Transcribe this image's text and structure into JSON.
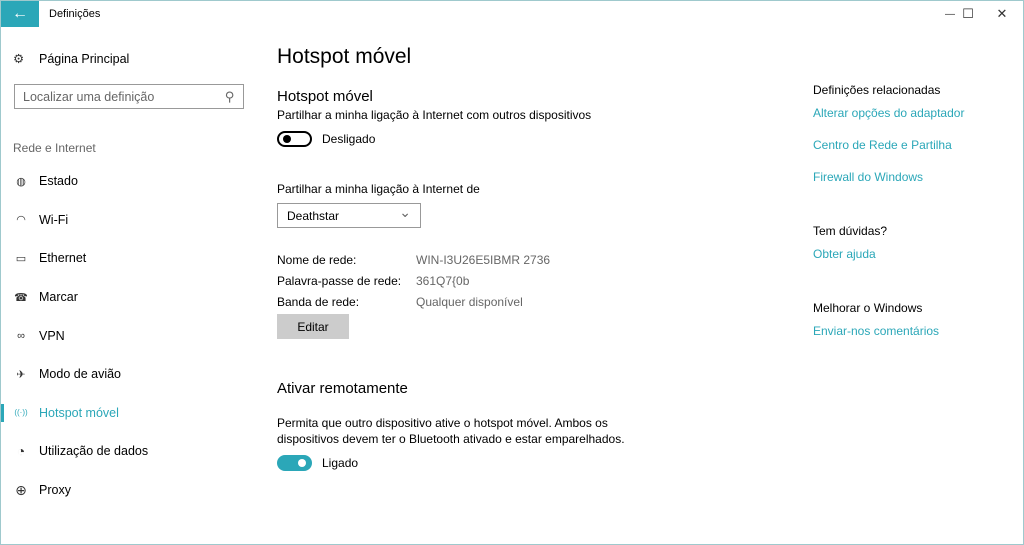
{
  "window": {
    "title": "Definições",
    "back_icon": "←",
    "minimize_icon": "—",
    "maximize_icon": "☐",
    "close_icon": "✕"
  },
  "sidebar": {
    "home_label": "Página Principal",
    "home_icon": "⚙",
    "search_placeholder": "Localizar uma definição",
    "search_icon": "⚲",
    "group_label": "Rede e Internet",
    "items": [
      {
        "label": "Estado",
        "icon": "◍",
        "active": false
      },
      {
        "label": "Wi-Fi",
        "icon": "◠",
        "active": false
      },
      {
        "label": "Ethernet",
        "icon": "▭",
        "active": false
      },
      {
        "label": "Marcar",
        "icon": "☎",
        "active": false
      },
      {
        "label": "VPN",
        "icon": "∞",
        "active": false
      },
      {
        "label": "Modo de avião",
        "icon": "✈",
        "active": false
      },
      {
        "label": "Hotspot móvel",
        "icon": "((·))",
        "active": true
      },
      {
        "label": "Utilização de dados",
        "icon": "◔",
        "active": false
      },
      {
        "label": "Proxy",
        "icon": "⊕",
        "active": false
      }
    ]
  },
  "main": {
    "page_title": "Hotspot móvel",
    "hotspot": {
      "heading": "Hotspot móvel",
      "description": "Partilhar a minha ligação à Internet com outros dispositivos",
      "toggle_state": "off",
      "toggle_label": "Desligado"
    },
    "share_from": {
      "label": "Partilhar a minha ligação à Internet de",
      "selected": "Deathstar",
      "chevron_icon": "⌄"
    },
    "network_info": [
      {
        "label": "Nome de rede:",
        "value": "WIN-I3U26E5IBMR 2736"
      },
      {
        "label": "Palavra-passe de rede:",
        "value": "361Q7{0b"
      },
      {
        "label": "Banda de rede:",
        "value": "Qualquer disponível"
      }
    ],
    "edit_button": "Editar",
    "remote": {
      "heading": "Ativar remotamente",
      "description_line1": "Permita que outro dispositivo ative o hotspot móvel. Ambos os",
      "description_line2": "dispositivos devem ter o Bluetooth ativado e estar emparelhados.",
      "toggle_state": "on",
      "toggle_label": "Ligado"
    }
  },
  "right_panel": {
    "related_heading": "Definições relacionadas",
    "related_links": [
      "Alterar opções do adaptador",
      "Centro de Rede e Partilha",
      "Firewall do Windows"
    ],
    "help_heading": "Tem dúvidas?",
    "help_link": "Obter ajuda",
    "improve_heading": "Melhorar o Windows",
    "improve_link": "Enviar-nos comentários"
  },
  "colors": {
    "accent": "#2ba7b8",
    "secondary_text": "#666666",
    "button_bg": "#cccccc"
  }
}
